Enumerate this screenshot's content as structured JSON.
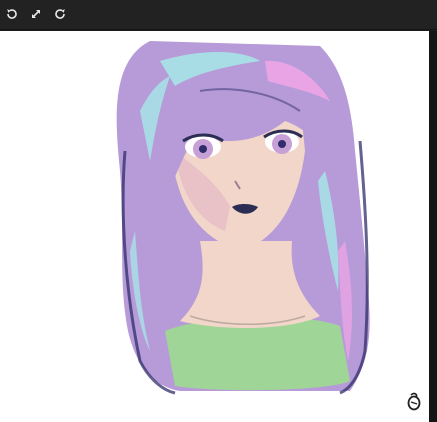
{
  "toolbar": {
    "buttons": [
      {
        "icon": "rotate-icon",
        "action": "rotate"
      },
      {
        "icon": "expand-icon",
        "action": "fullscreen"
      },
      {
        "icon": "rotate-alt-icon",
        "action": "rotate-alt"
      }
    ]
  },
  "canvas": {
    "background": "#ffffff",
    "artwork": {
      "subject": "digital-painting-portrait",
      "signature": ""
    },
    "colors": {
      "hair_base": "#b79bd8",
      "hair_shadow": "#2f2d6b",
      "hair_highlight": "#a7e4e8",
      "hair_pink": "#e9a4e6",
      "skin": "#f1d6c9",
      "skin_shadow": "#e3b4c6",
      "shirt": "#9fd596",
      "lips": "#2b2d55"
    }
  }
}
